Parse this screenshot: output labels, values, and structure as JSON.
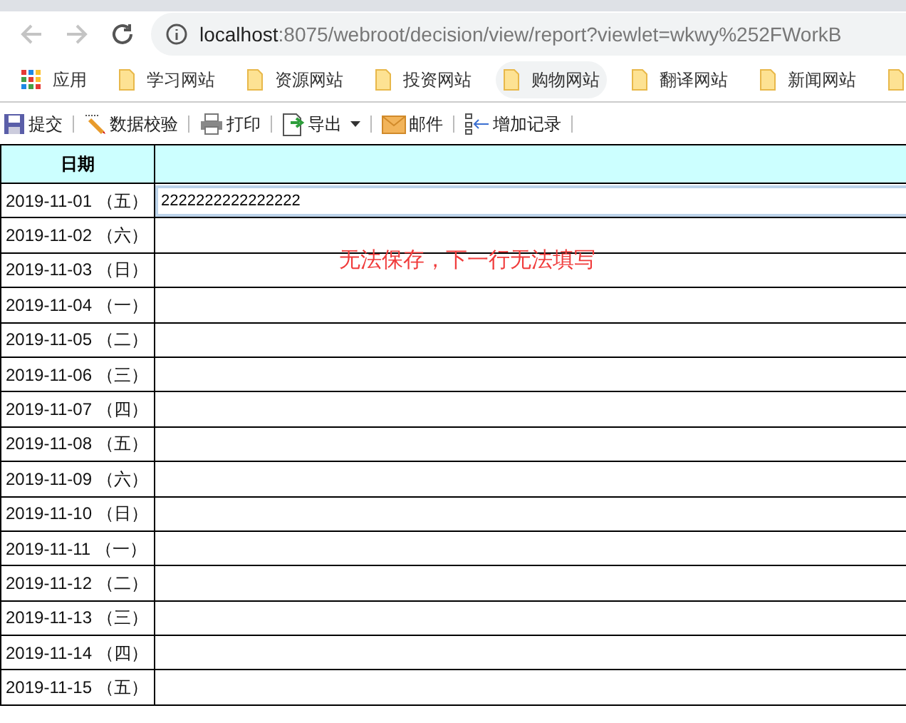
{
  "browser": {
    "url_host": "localhost",
    "url_rest": ":8075/webroot/decision/view/report?viewlet=wkwy%252FWorkB",
    "bookmarks": [
      {
        "label": "应用",
        "kind": "apps",
        "selected": false
      },
      {
        "label": "学习网站",
        "kind": "folder",
        "selected": false
      },
      {
        "label": "资源网站",
        "kind": "folder",
        "selected": false
      },
      {
        "label": "投资网站",
        "kind": "folder",
        "selected": false
      },
      {
        "label": "购物网站",
        "kind": "folder",
        "selected": true
      },
      {
        "label": "翻译网站",
        "kind": "folder",
        "selected": false
      },
      {
        "label": "新闻网站",
        "kind": "folder",
        "selected": false
      },
      {
        "kind": "folder",
        "selected": false
      }
    ]
  },
  "toolbar": [
    {
      "label": "提交",
      "kind": "save"
    },
    {
      "label": "数据校验",
      "kind": "check"
    },
    {
      "label": "打印",
      "kind": "print"
    },
    {
      "label": "导出",
      "kind": "export",
      "dropdown": true
    },
    {
      "label": "邮件",
      "kind": "mail"
    },
    {
      "label": "增加记录",
      "kind": "add"
    }
  ],
  "table": {
    "columns": [
      "日期",
      ""
    ],
    "rows": [
      {
        "date": "2019-11-01 （五）",
        "value": "2222222222222222",
        "editing": true
      },
      {
        "date": "2019-11-02 （六）"
      },
      {
        "date": "2019-11-03 （日）"
      },
      {
        "date": "2019-11-04 （一）"
      },
      {
        "date": "2019-11-05 （二）"
      },
      {
        "date": "2019-11-06 （三）"
      },
      {
        "date": "2019-11-07 （四）"
      },
      {
        "date": "2019-11-08 （五）"
      },
      {
        "date": "2019-11-09 （六）"
      },
      {
        "date": "2019-11-10 （日）"
      },
      {
        "date": "2019-11-11 （一）"
      },
      {
        "date": "2019-11-12 （二）"
      },
      {
        "date": "2019-11-13 （三）"
      },
      {
        "date": "2019-11-14 （四）"
      },
      {
        "date": "2019-11-15 （五）"
      }
    ]
  },
  "annotation": "无法保存，下一行无法填写"
}
